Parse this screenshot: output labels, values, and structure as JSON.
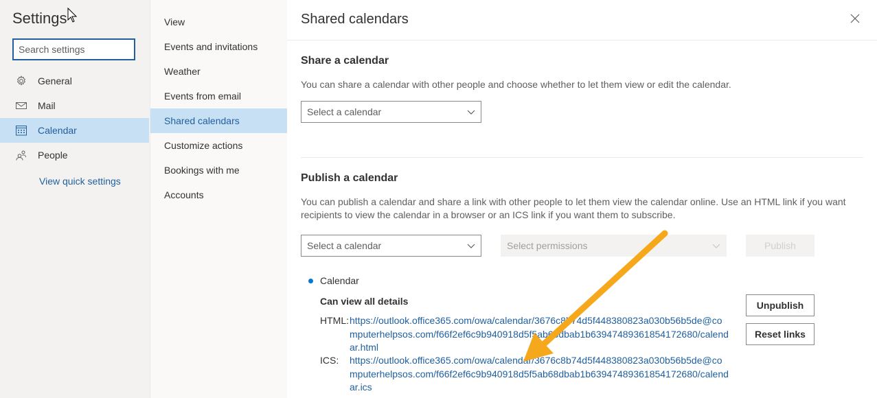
{
  "settings": {
    "title": "Settings",
    "search_placeholder": "Search settings"
  },
  "nav": {
    "items": [
      {
        "label": "General",
        "icon": "gear-icon"
      },
      {
        "label": "Mail",
        "icon": "mail-icon"
      },
      {
        "label": "Calendar",
        "icon": "calendar-icon",
        "active": true
      },
      {
        "label": "People",
        "icon": "people-icon"
      }
    ],
    "quick_settings": "View quick settings"
  },
  "subnav": {
    "items": [
      {
        "label": "View"
      },
      {
        "label": "Events and invitations"
      },
      {
        "label": "Weather"
      },
      {
        "label": "Events from email"
      },
      {
        "label": "Shared calendars",
        "active": true
      },
      {
        "label": "Customize actions"
      },
      {
        "label": "Bookings with me"
      },
      {
        "label": "Accounts"
      }
    ]
  },
  "pane": {
    "title": "Shared calendars",
    "share": {
      "title": "Share a calendar",
      "description": "You can share a calendar with other people and choose whether to let them view or edit the calendar.",
      "select_placeholder": "Select a calendar"
    },
    "publish": {
      "title": "Publish a calendar",
      "description": "You can publish a calendar and share a link with other people to let them view the calendar online. Use an HTML link if you want recipients to view the calendar in a browser or an ICS link if you want them to subscribe.",
      "select_calendar": "Select a calendar",
      "select_permissions": "Select permissions",
      "publish_label": "Publish"
    },
    "published": {
      "calendar_name": "Calendar",
      "permission": "Can view all details",
      "html_label": "HTML:",
      "html_link": "https://outlook.office365.com/owa/calendar/3676c8b74d5f448380823a030b56b5de@computerhelpsos.com/f66f2ef6c9b940918d5f5ab68dbab1b63947489361854172680/calendar.html",
      "ics_label": "ICS:",
      "ics_link": "https://outlook.office365.com/owa/calendar/3676c8b74d5f448380823a030b56b5de@computerhelpsos.com/f66f2ef6c9b940918d5f5ab68dbab1b63947489361854172680/calendar.ics",
      "unpublish_label": "Unpublish",
      "reset_label": "Reset links"
    }
  },
  "colors": {
    "accent": "#1f5f9e",
    "selection": "#c7e0f4",
    "annotation_arrow": "#f5a81c"
  }
}
